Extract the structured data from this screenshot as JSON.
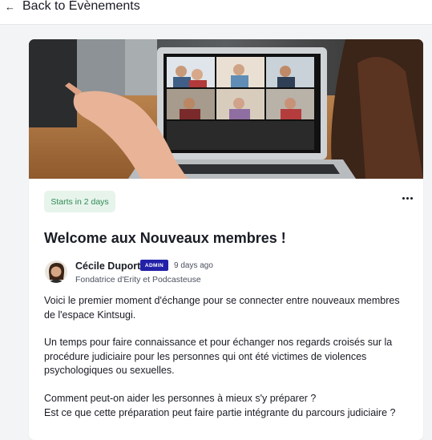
{
  "header": {
    "back_label": "Back to Évènements"
  },
  "event": {
    "starts_badge": "Starts in 2 days",
    "title": "Welcome aux Nouveaux membres !",
    "author": {
      "name": "Cécile Duport",
      "badge": "ADMIN",
      "posted": "9 days ago",
      "role": "Fondatrice d'Erity et Podcasteuse"
    },
    "paragraphs": [
      "Voici le premier moment d'échange pour se connecter entre nouveaux membres de l'espace Kintsugi.",
      "Un temps pour faire connaissance et pour échanger nos regards croisés sur la procédure judiciaire pour les personnes qui ont été victimes de violences psychologiques ou sexuelles.",
      "Comment peut-on aider les personnes à mieux s'y préparer ?",
      "Est ce que cette préparation peut faire partie intégrante du parcours judiciaire ?"
    ]
  },
  "colors": {
    "badge_bg": "#e7f4ec",
    "badge_text": "#2f8a54",
    "admin_badge": "#2321a8"
  }
}
